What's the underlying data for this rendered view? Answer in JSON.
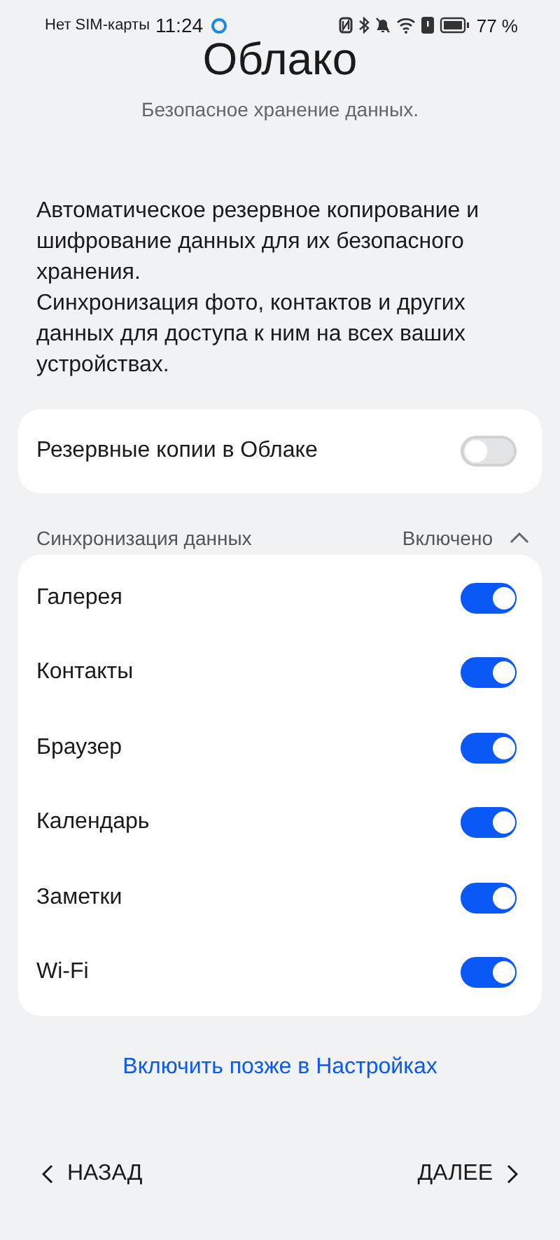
{
  "status_bar": {
    "carrier": "Нет SIM-карты",
    "time": "11:24",
    "battery": "77 %"
  },
  "title": "Облако",
  "subtitle": "Безопасное хранение данных.",
  "description": [
    "Автоматическое резервное копирование и шифрование данных для их безопасного хранения.",
    "Синхронизация фото, контактов и других данных для доступа к ним на всех ваших устройствах."
  ],
  "backup": {
    "label": "Резервные копии в Облаке",
    "on": false
  },
  "sync_section": {
    "title": "Синхронизация данных",
    "status": "Включено",
    "expanded": true
  },
  "sync_items": [
    {
      "label": "Галерея",
      "on": true
    },
    {
      "label": "Контакты",
      "on": true
    },
    {
      "label": "Браузер",
      "on": true
    },
    {
      "label": "Календарь",
      "on": true
    },
    {
      "label": "Заметки",
      "on": true
    },
    {
      "label": "Wi-Fi",
      "on": true
    }
  ],
  "later_link": "Включить позже в Настройках",
  "nav": {
    "back": "НАЗАД",
    "next": "ДАЛЕЕ"
  }
}
